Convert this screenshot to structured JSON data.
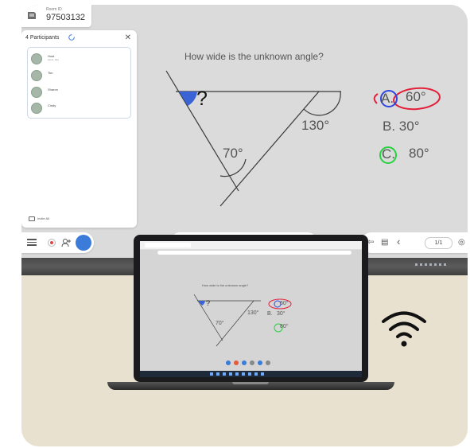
{
  "room": {
    "label": "Room ID",
    "id": "97503132"
  },
  "participants": {
    "title": "4 Participants",
    "items": [
      {
        "name": "Host",
        "sub": "(Host, Me)"
      },
      {
        "name": "Tim",
        "sub": ""
      },
      {
        "name": "Sharon",
        "sub": ""
      },
      {
        "name": "Cindy",
        "sub": ""
      }
    ],
    "invite_label": "Invite All"
  },
  "question": {
    "text": "How wide is the unknown angle?",
    "unknown": "?",
    "angle_right": "130°",
    "angle_bottom": "70°",
    "options": [
      {
        "letter": "A.",
        "value": "60°"
      },
      {
        "letter": "B.",
        "value": "30°"
      },
      {
        "letter": "C.",
        "value": "80°"
      }
    ]
  },
  "toolbar": {
    "page": "1/1"
  },
  "colors": {
    "annotation_blue": "#3046e0",
    "annotation_red": "#e2203a",
    "annotation_green": "#27d23f",
    "wedge_blue": "#3a63d6",
    "accent": "#3b7bd9"
  },
  "icons": [
    "menu-icon",
    "record-icon",
    "users-icon",
    "refresh-icon",
    "close-icon",
    "wifi-icon",
    "undo-icon",
    "export-icon",
    "prev-icon",
    "settings-icon",
    "window-icon"
  ]
}
